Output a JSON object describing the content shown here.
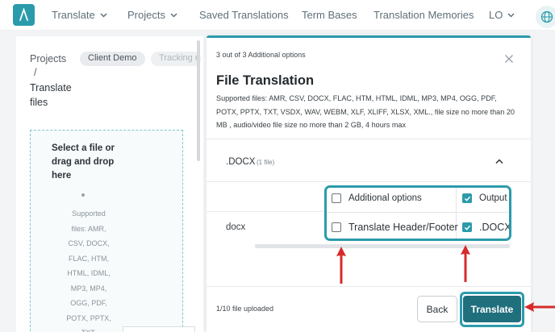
{
  "nav": {
    "items": [
      {
        "label": "Translate",
        "has_chevron": true
      },
      {
        "label": "Projects",
        "has_chevron": true
      },
      {
        "label": "Saved Translations",
        "has_chevron": false
      },
      {
        "label": "Term Bases",
        "has_chevron": false
      },
      {
        "label": "Translation Memories",
        "has_chevron": false
      },
      {
        "label": "LO",
        "has_chevron": true
      }
    ],
    "logo_icon": "lambda-logo-icon",
    "globe_icon": "globe-icon",
    "accent_color": "#2b9bab"
  },
  "breadcrumb": {
    "root": "Projects",
    "separator": "/",
    "current_line1": "Translate",
    "current_line2": "files",
    "chips": [
      "Client Demo",
      "Tracking n"
    ]
  },
  "dropzone": {
    "title": "Select a file or drag and drop here",
    "supported": "Supported files: AMR, CSV, DOCX, FLAC, HTM, HTML, IDML, MP3, MP4, OGG, PDF, POTX, PPTX, TXT,"
  },
  "modal": {
    "step": "3 out of 3 Additional options",
    "title": "File Translation",
    "subtitle": "Supported files: AMR, CSV, DOCX, FLAC, HTM, HTML, IDML, MP3, MP4, OGG, PDF, POTX, PPTX, TXT, VSDX, WAV, WEBM, XLF, XLIFF, XLSX, XML., file size no more than 20 MB , audio/video file size no more than 2 GB, 4 hours max",
    "format_group": {
      "label": ".DOCX",
      "count": "(1 file)",
      "expanded": true
    },
    "file_name": "docx",
    "options_header": {
      "additional_label": "Additional options",
      "additional_checked": false,
      "output_label": "Output",
      "output_checked": true
    },
    "options_row": {
      "header_footer_label": "Translate Header/Footer",
      "header_footer_checked": false,
      "output_format_label": ".DOCX",
      "output_format_checked": true
    },
    "footer": {
      "uploaded": "1/10 file uploaded",
      "back_label": "Back",
      "translate_label": "Translate"
    }
  },
  "annotation_color": "#d62b2b"
}
